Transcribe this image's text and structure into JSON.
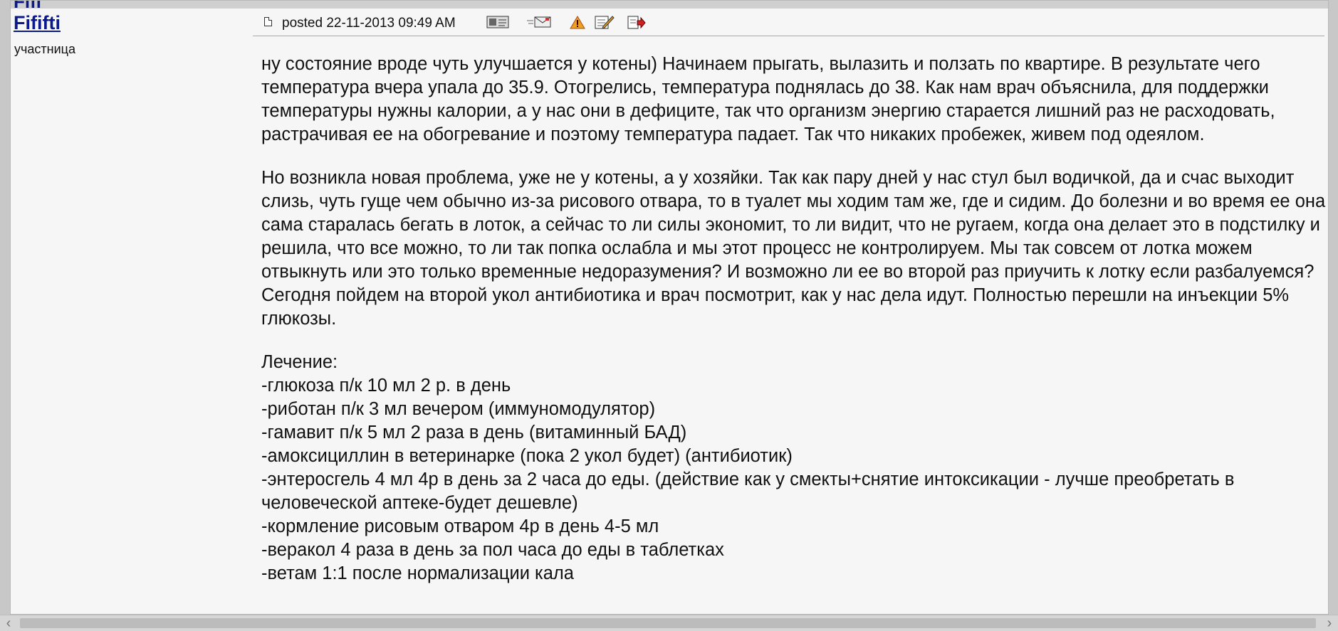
{
  "post": {
    "prev_author_fragment": "Fifi",
    "author": "Fififti",
    "role": "участница",
    "posted": "posted 22-11-2013 09:49 AM",
    "tool_icons": [
      "profile-icon",
      "private-message-icon",
      "report-icon",
      "edit-icon",
      "quote-icon"
    ],
    "paragraphs": [
      "ну состояние вроде чуть улучшается у котены) Начинаем прыгать, вылазить и ползать по квартире. В результате чего температура вчера упала до 35.9. Отогрелись, температура поднялась до 38. Как нам врач объяснила, для поддержки температуры нужны калории, а у нас они в дефиците, так что организм энергию старается лишний раз не расходовать, растрачивая ее на обогревание и поэтому температура падает. Так что никаких пробежек, живем под одеялом.",
      "Но возникла новая проблема, уже не у котены, а у хозяйки. Так как пару дней у нас стул был водичкой, да и счас выходит слизь, чуть гуще чем обычно из-за рисового отвара, то в туалет мы ходим там же, где и сидим. До болезни и во время ее она сама старалась бегать в лоток, а сейчас то ли силы экономит, то ли видит, что не ругаем, когда она делает это в подстилку и решила, что все можно, то ли так попка ослабла и мы этот процесс не контролируем. Мы так совсем от лотка можем отвыкнуть или это только временные недоразумения? И возможно ли ее во второй раз приучить к лотку если разбалуемся? Сегодня пойдем на второй укол антибиотика и врач посмотрит, как у нас дела идут. Полностью перешли на инъекции 5% глюкозы."
    ],
    "treatment_heading": "Лечение:",
    "treatment": [
      "-глюкоза п/к 10 мл 2 р. в день",
      "-риботан п/к 3 мл вечером (иммуномодулятор)",
      "-гамавит п/к 5 мл 2 раза в день (витаминный БАД)",
      "-амоксициллин в ветеринарке (пока 2 укол будет) (антибиотик)",
      "-энтеросгель 4 мл 4р в день за 2 часа до еды. (действие как у смекты+снятие интоксикации - лучше преобретать в человеческой аптеке-будет дешевле)",
      "-кормление рисовым отваром 4р в день 4-5 мл",
      "-веракол 4 раза в день за пол часа до еды в таблетках",
      "-ветам 1:1 после нормализации кала"
    ]
  }
}
